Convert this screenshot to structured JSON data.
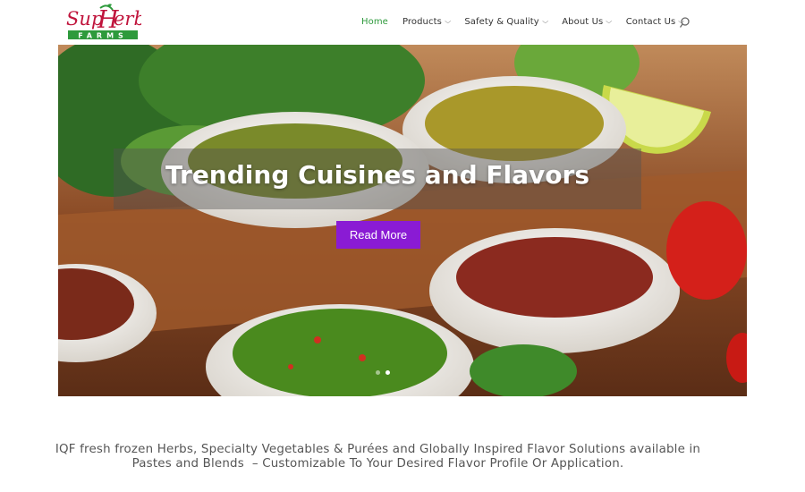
{
  "brand": {
    "logo_main": "SupHerb",
    "logo_sub": "FARMS",
    "colors": {
      "logo_red": "#c0143c",
      "logo_green": "#2e9a3c"
    }
  },
  "nav": {
    "items": [
      {
        "label": "Home",
        "active": true,
        "has_dropdown": false
      },
      {
        "label": "Products",
        "active": false,
        "has_dropdown": true
      },
      {
        "label": "Safety & Quality",
        "active": false,
        "has_dropdown": true
      },
      {
        "label": "About Us",
        "active": false,
        "has_dropdown": true
      },
      {
        "label": "Contact Us",
        "active": false,
        "has_dropdown": true
      }
    ],
    "search_icon": "search-icon",
    "active_color": "#2e9a3c"
  },
  "hero": {
    "title": "Trending Cuisines and Flavors",
    "button_label": "Read More",
    "button_color": "#8a1bd4",
    "slides": 2,
    "active_slide": 2
  },
  "tagline": {
    "line1": "IQF fresh frozen Herbs, Specialty Vegetables & Purées and Globally Inspired Flavor Solutions available in",
    "line2": "Pastes and Blends  – Customizable To Your Desired Flavor Profile Or Application."
  }
}
